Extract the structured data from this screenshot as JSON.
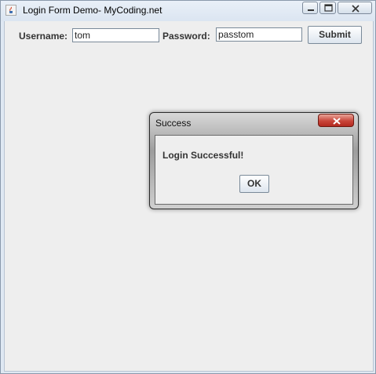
{
  "window": {
    "title": "Login Form Demo- MyCoding.net"
  },
  "form": {
    "username_label": "Username:",
    "username_value": "tom",
    "password_label": "Password:",
    "password_value": "passtom",
    "submit_label": "Submit"
  },
  "dialog": {
    "title": "Success",
    "message": "Login Successful!",
    "ok_label": "OK"
  },
  "colors": {
    "window_frame": "#dfe8f3",
    "client_background": "#eeeeee",
    "dialog_close_red": "#c9453a"
  }
}
